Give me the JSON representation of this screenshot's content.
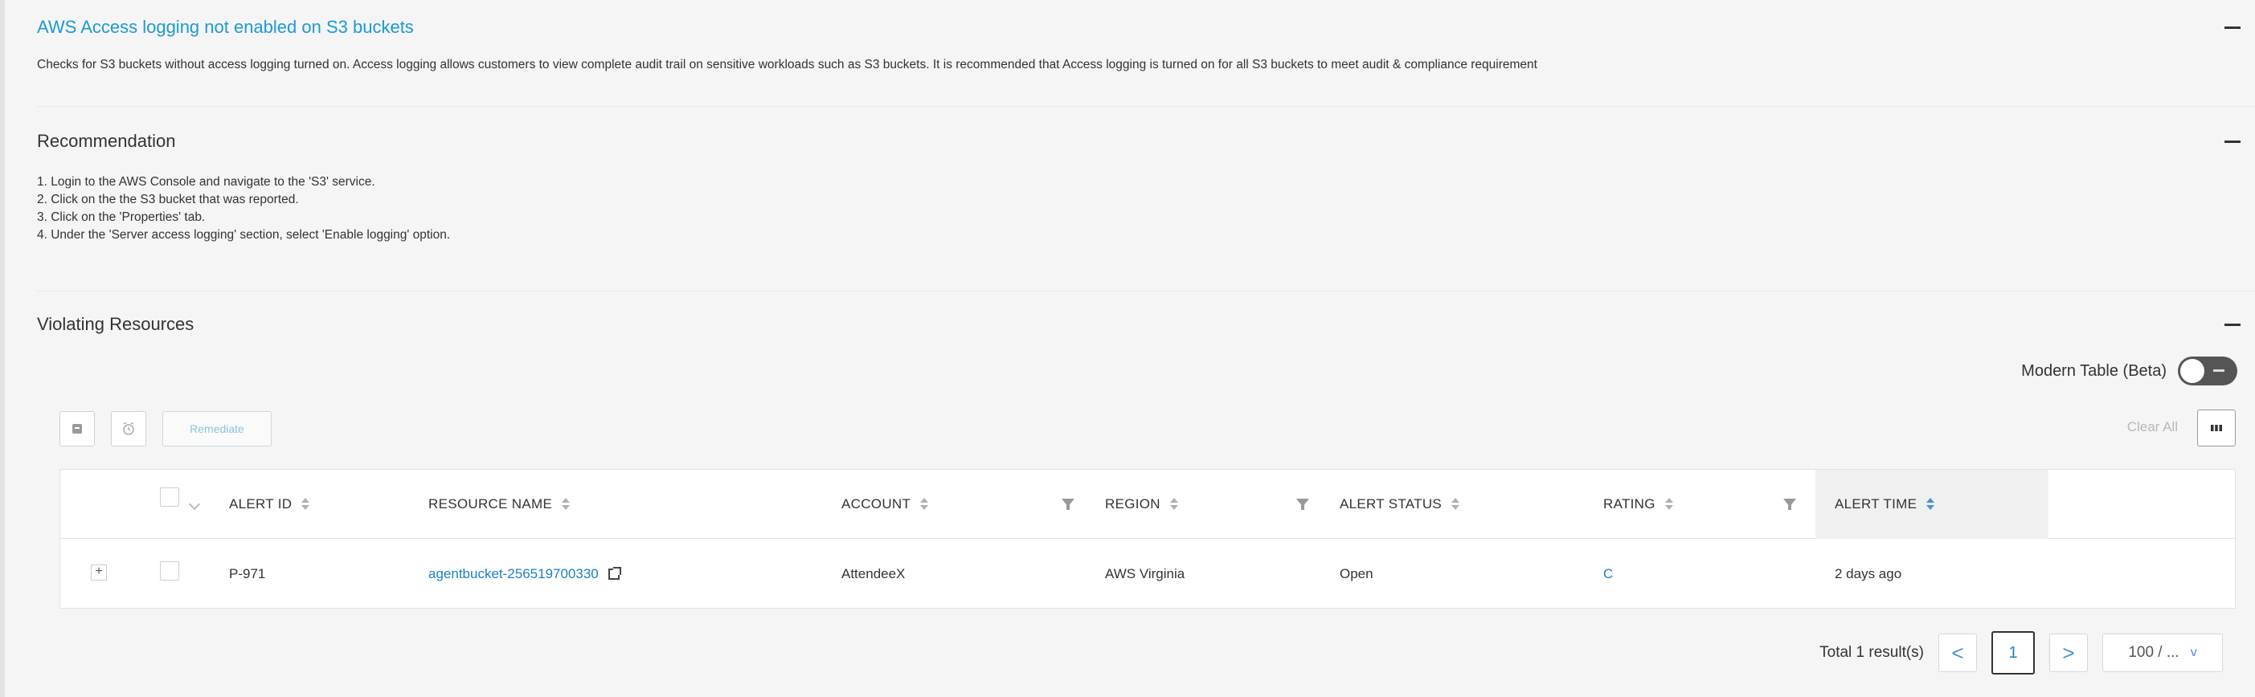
{
  "policy": {
    "title": "AWS Access logging not enabled on S3 buckets",
    "description": "Checks for S3 buckets without access logging turned on. Access logging allows customers to view complete audit trail on sensitive workloads such as S3 buckets. It is recommended that Access logging is turned on for all S3 buckets to meet audit & compliance requirement"
  },
  "recommendation": {
    "title": "Recommendation",
    "steps": [
      "1. Login to the AWS Console and navigate to the 'S3' service.",
      "2. Click on the the S3 bucket that was reported.",
      "3. Click on the 'Properties' tab.",
      "4. Under the 'Server access logging' section, select 'Enable logging' option."
    ]
  },
  "violating": {
    "title": "Violating Resources",
    "modern_table_label": "Modern Table (Beta)",
    "remediate_label": "Remediate",
    "clear_all_label": "Clear All",
    "columns": {
      "alert_id": "ALERT ID",
      "resource_name": "RESOURCE NAME",
      "account": "ACCOUNT",
      "region": "REGION",
      "alert_status": "ALERT STATUS",
      "rating": "RATING",
      "alert_time": "ALERT TIME"
    },
    "rows": [
      {
        "expand": "+",
        "alert_id": "P-971",
        "resource_name": "agentbucket-256519700330",
        "account": "AttendeeX",
        "region": "AWS Virginia",
        "alert_status": "Open",
        "rating": "C",
        "alert_time": "2 days ago"
      }
    ]
  },
  "pagination": {
    "total": "Total 1 result(s)",
    "prev": "<",
    "current": "1",
    "next": ">",
    "page_size": "100 / ...",
    "page_size_caret": "v"
  },
  "colors": {
    "link": "#1a9ad6",
    "background": "#f5f5f5"
  }
}
